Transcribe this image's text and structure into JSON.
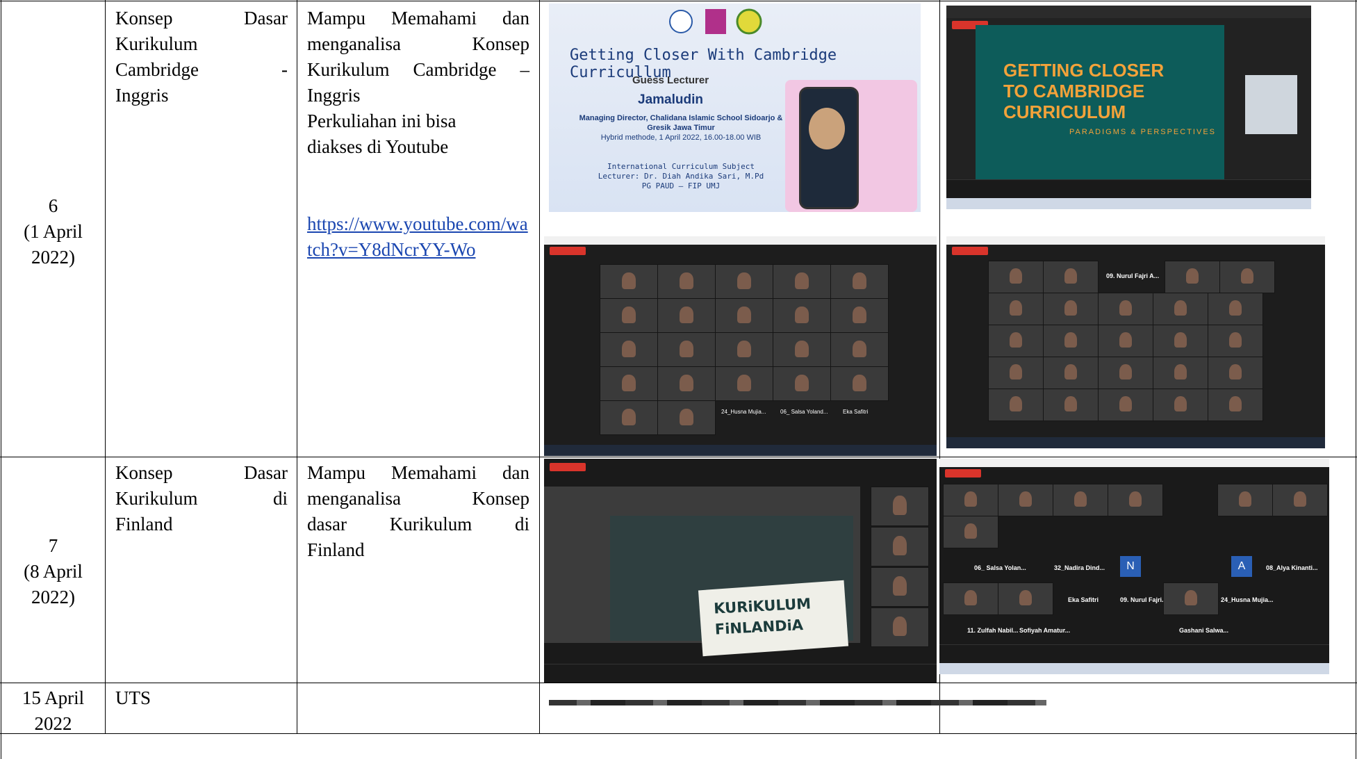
{
  "rows": [
    {
      "meeting": [
        "6",
        "(1 April",
        "2022)"
      ],
      "topic": [
        "Konsep",
        "Dasar",
        "Kurikulum",
        "Cambridge",
        "-",
        "Inggris"
      ],
      "outcome": {
        "lines": [
          "Mampu Memahami dan",
          "menganalisa Konsep",
          "Kurikulum Cambridge –",
          "Inggris",
          "Perkuliahan ini bisa",
          "diakses di Youtube"
        ],
        "link": "https://www.youtube.com/watch?v=Y8dNcrYY-Wo"
      },
      "images": {
        "poster": {
          "title": "Getting Closer With Cambridge Curricullum",
          "label": "Guess Lecturer",
          "speaker": "Jamaludin",
          "role": "Managing Director, Chalidana Islamic School Sidoarjo & Gresik Jawa Timur",
          "schedule": "Hybrid methode, 1 April 2022, 16.00-18.00 WIB",
          "subject": "International Curriculum Subject",
          "lecturer": "Lecturer: Dr. Diah Andika Sari, M.Pd",
          "program": "PG PAUD – FIP UMJ"
        },
        "slide": {
          "title_lines": [
            "GETTING CLOSER",
            "TO CAMBRIDGE",
            "CURRICULUM"
          ],
          "subtitle": "PARADIGMS & PERSPECTIVES"
        },
        "gallery_names_1": [
          "24_Husna Mujia...",
          "06_ Salsa Yoland...",
          "Eka Safitri"
        ],
        "gallery_names_2": [
          "09. Nurul Fajri A..."
        ]
      }
    },
    {
      "meeting": [
        "7",
        "(8 April",
        "2022)"
      ],
      "topic": [
        "Konsep",
        "Dasar",
        "Kurikulum",
        "di",
        "Finland"
      ],
      "outcome": {
        "lines": [
          "Mampu Memahami dan",
          "menganalisa Konsep",
          "dasar Kurikulum di",
          "Finland"
        ]
      },
      "images": {
        "slide_words": [
          "KURiKULUM",
          "FiNLANDiA"
        ],
        "gallery_names": [
          "06_ Salsa Yolan...",
          "32_Nadira Dind...",
          "08_Alya Kinanti...",
          "Eka Safitri",
          "09. Nurul Fajri...",
          "24_Husna Mujia...",
          "11. Zulfah Nabil...",
          "Sofiyah Amatur...",
          "Gashani Salwa..."
        ]
      }
    },
    {
      "meeting": [
        "15 April",
        "2022"
      ],
      "topic": [
        "UTS"
      ]
    }
  ]
}
